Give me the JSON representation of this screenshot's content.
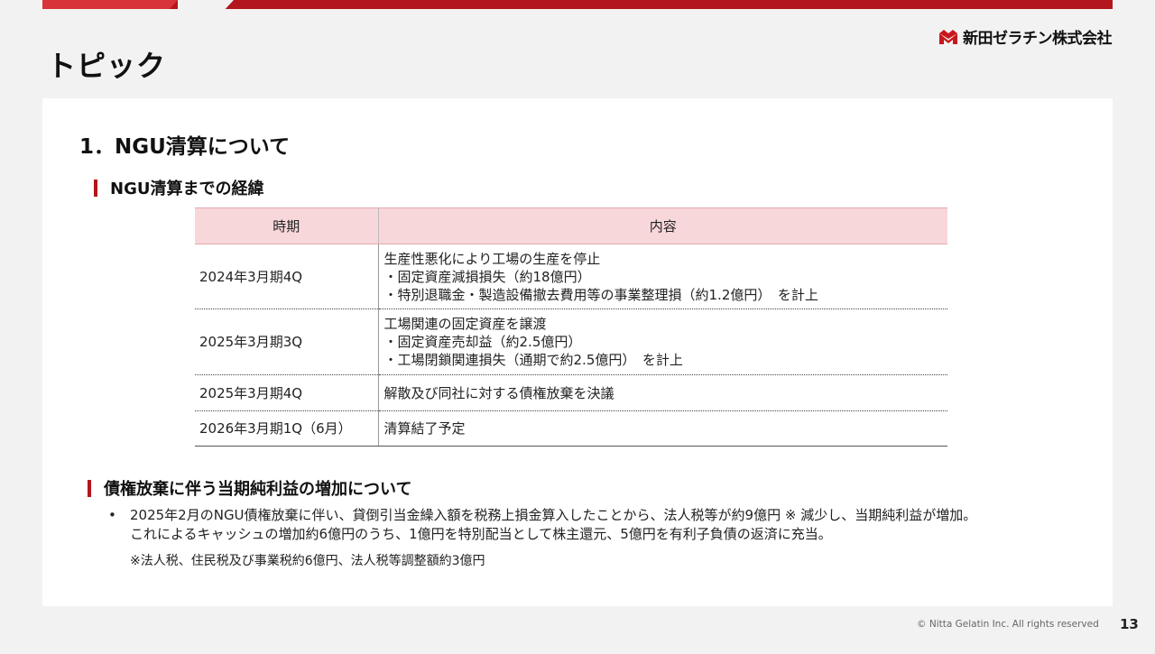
{
  "header": {
    "page_title": "トピック",
    "logo_text": "新田ゼラチン株式会社"
  },
  "section": {
    "title": "1．NGU清算について"
  },
  "history": {
    "heading": "NGU清算までの経緯",
    "columns": [
      "時期",
      "内容"
    ],
    "rows": [
      {
        "period": "2024年3月期4Q",
        "lines": [
          "生産性悪化により工場の生産を停止",
          "・固定資産減損損失（約18億円）",
          "・特別退職金・製造設備撤去費用等の事業整理損（約1.2億円）　を計上"
        ]
      },
      {
        "period": "2025年3月期3Q",
        "lines": [
          "工場関連の固定資産を譲渡",
          "・固定資産売却益（約2.5億円）",
          "・工場閉鎖関連損失（通期で約2.5億円）　を計上"
        ]
      },
      {
        "period": "2025年3月期4Q",
        "lines": [
          "解散及び同社に対する債権放棄を決議"
        ]
      },
      {
        "period": "2026年3月期1Q（6月）",
        "lines": [
          "清算結了予定"
        ]
      }
    ]
  },
  "profit": {
    "heading": "債権放棄に伴う当期純利益の増加について",
    "bullet_mark": "•",
    "bullet_line1": "2025年2月のNGU債権放棄に伴い、貸倒引当金繰入額を税務上損金算入したことから、法人税等が約9億円 ※ 減少し、当期純利益が増加。",
    "bullet_line2": "これによるキャッシュの増加約6億円のうち、1億円を特別配当として株主還元、5億円を有利子負債の返済に充当。",
    "note": "※法人税、住民税及び事業税約6億円、法人税等調整額約3億円"
  },
  "footer": {
    "copyright": "© Nitta Gelatin Inc. All rights reserved",
    "page_number": "13"
  },
  "colors": {
    "brand_red": "#b3161c",
    "header_pink": "#f8d7da"
  }
}
